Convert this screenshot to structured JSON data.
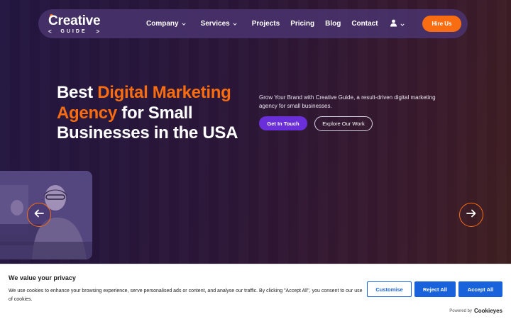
{
  "brand": {
    "logo_top": "Creative",
    "logo_bottom": "GUIDE",
    "logo_left_bracket": "<",
    "logo_right_bracket": ">",
    "accent_color": "#f86c12",
    "purple_color": "#6a2fd8"
  },
  "nav": {
    "items": [
      {
        "label": "Company",
        "has_dropdown": true
      },
      {
        "label": "Services",
        "has_dropdown": true
      },
      {
        "label": "Projects",
        "has_dropdown": false
      },
      {
        "label": "Pricing",
        "has_dropdown": false
      },
      {
        "label": "Blog",
        "has_dropdown": false
      },
      {
        "label": "Contact",
        "has_dropdown": false
      }
    ],
    "user_icon": "user-icon",
    "hire_label": "Hire Us"
  },
  "hero": {
    "title_part1": "Best ",
    "title_accent": "Digital Marketing Agency",
    "title_part2": " for Small Businesses in the USA",
    "description": "Grow Your Brand with Creative Guide, a result-driven digital marketing agency for small businesses.",
    "primary_cta": "Get In Touch",
    "secondary_cta": "Explore Our Work"
  },
  "slider": {
    "prev_icon": "arrow-left-icon",
    "next_icon": "arrow-right-icon"
  },
  "cookie": {
    "title": "We value your privacy",
    "text": "We use cookies to enhance your browsing experience, serve personalised ads or content, and analyse our traffic. By clicking \"Accept All\", you consent to our use of cookies.",
    "customise_label": "Customise",
    "reject_label": "Reject All",
    "accept_label": "Accept All",
    "powered_by": "Powered by",
    "powered_brand": "Cookieyes",
    "button_color": "#1863dc"
  }
}
